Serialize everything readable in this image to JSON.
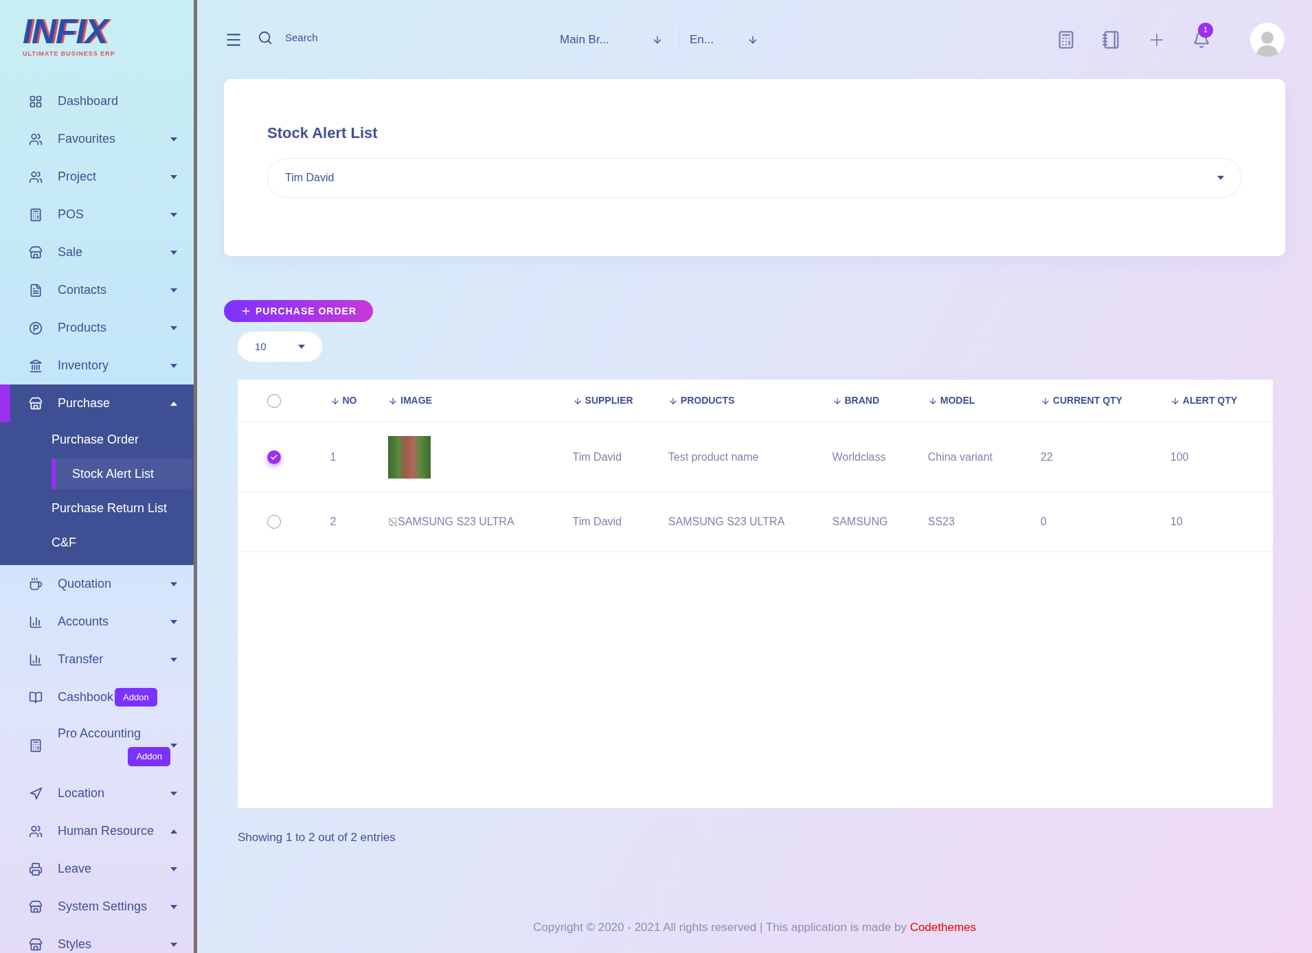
{
  "logo": {
    "name": "INFIX",
    "tagline": "ULTIMATE BUSINESS ERP"
  },
  "sidebar": {
    "items": [
      {
        "label": "Dashboard",
        "selected": false
      },
      {
        "label": "Favourites",
        "expanded": false,
        "selected": false
      },
      {
        "label": "Project",
        "expanded": false,
        "selected": false
      },
      {
        "label": "POS",
        "expanded": false,
        "selected": false
      },
      {
        "label": "Sale",
        "expanded": false,
        "selected": false
      },
      {
        "label": "Contacts",
        "expanded": false,
        "selected": false
      },
      {
        "label": "Products",
        "expanded": false,
        "selected": false
      },
      {
        "label": "Inventory",
        "expanded": false,
        "selected": false
      },
      {
        "label": "Purchase",
        "expanded": true,
        "selected": true,
        "children": [
          {
            "label": "Purchase Order",
            "selected": false
          },
          {
            "label": "Stock Alert List",
            "selected": true
          },
          {
            "label": "Purchase Return List",
            "selected": false
          },
          {
            "label": "C&F",
            "selected": false
          }
        ]
      },
      {
        "label": "Quotation",
        "expanded": false,
        "selected": false
      },
      {
        "label": "Accounts",
        "expanded": false,
        "selected": false
      },
      {
        "label": "Transfer",
        "expanded": false,
        "selected": false
      },
      {
        "label": "Cashbook",
        "badge": "Addon",
        "selected": false
      },
      {
        "label": "Pro Accounting",
        "badge": "Addon",
        "expanded": false,
        "selected": false
      },
      {
        "label": "Location",
        "expanded": false,
        "selected": false
      },
      {
        "label": "Human Resource",
        "expanded": true,
        "selected": false
      },
      {
        "label": "Leave",
        "expanded": false,
        "selected": false
      },
      {
        "label": "System Settings",
        "expanded": false,
        "selected": false
      },
      {
        "label": "Styles",
        "expanded": false,
        "selected": false
      }
    ]
  },
  "topbar": {
    "search_placeholder": "Search",
    "branch": "Main Br...",
    "language": "En...",
    "notification_count": "1"
  },
  "card": {
    "title": "Stock Alert List",
    "supplier_select": "Tim David"
  },
  "purchase_order_button": "PURCHASE ORDER",
  "page_size": "10",
  "table": {
    "header_checked": false,
    "columns": [
      "NO",
      "IMAGE",
      "SUPPLIER",
      "PRODUCTS",
      "BRAND",
      "MODEL",
      "CURRENT QTY",
      "ALERT QTY"
    ],
    "rows": [
      {
        "checked": true,
        "no": "1",
        "image": {
          "kind": "photo"
        },
        "supplier": "Tim David",
        "product": "Test product name",
        "brand": "Worldclass",
        "model": "China variant",
        "current_qty": "22",
        "alert_qty": "100"
      },
      {
        "checked": false,
        "no": "2",
        "image": {
          "kind": "broken",
          "alt": "SAMSUNG S23 ULTRA"
        },
        "supplier": "Tim David",
        "product": "SAMSUNG S23 ULTRA",
        "brand": "SAMSUNG",
        "model": "SS23",
        "current_qty": "0",
        "alert_qty": "10"
      }
    ]
  },
  "showing": "Showing 1 to 2 out of 2 entries",
  "footer": {
    "text": "Copyright © 2020 - 2021 All rights reserved | This application is made by ",
    "link": "Codethemes"
  }
}
